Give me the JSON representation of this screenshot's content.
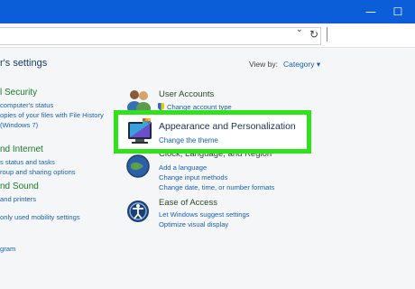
{
  "window": {
    "minimize": "—",
    "maximize": "☐"
  },
  "address": {
    "chevron": "⌄",
    "refresh": "↻"
  },
  "page": {
    "title": "r's settings"
  },
  "viewby": {
    "label": "View by:",
    "value": "Category ▾"
  },
  "left": {
    "security": {
      "heading": "l Security",
      "links": [
        "computer's status",
        "opies of your files with File History",
        "(Windows 7)"
      ]
    },
    "network": {
      "heading": "nd Internet",
      "links": [
        "s status and tasks",
        "roup and sharing options"
      ]
    },
    "hardware": {
      "heading": "nd Sound",
      "links": [
        "and printers"
      ]
    },
    "mobility": {
      "links": [
        "only used mobility settings"
      ]
    },
    "programs": {
      "links": [
        "gram"
      ]
    }
  },
  "right": {
    "accounts": {
      "title": "User Accounts",
      "links": [
        "Change account type"
      ]
    },
    "appearance": {
      "title": "Appearance and Personalization",
      "link": "Change the theme"
    },
    "clock": {
      "title": "Clock, Language, and Region",
      "links": [
        "Add a language",
        "Change input methods",
        "Change date, time, or number formats"
      ]
    },
    "ease": {
      "title": "Ease of Access",
      "links": [
        "Let Windows suggest settings",
        "Optimize visual display"
      ]
    }
  },
  "colors": {
    "titlebar": "#0b5ed7",
    "highlight_border": "#2fe21a",
    "link": "#1a5fb4",
    "category_heading": "#1a7a2a"
  }
}
